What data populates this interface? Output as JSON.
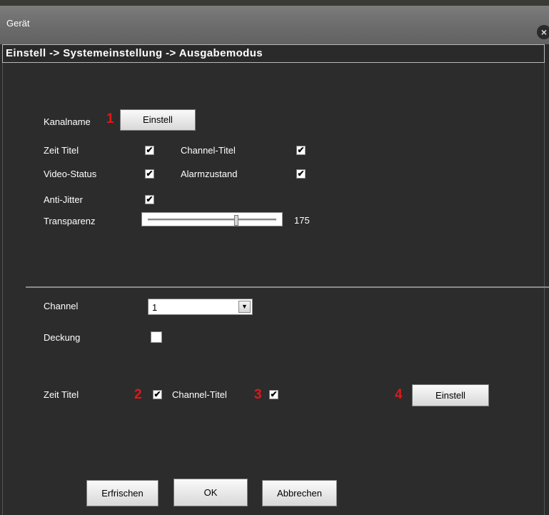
{
  "window": {
    "title": "Gerät",
    "close_icon": "×"
  },
  "breadcrumb": "Einstell -> Systemeinstellung -> Ausgabemodus",
  "section1": {
    "kanalname_label": "Kanalname",
    "kanalname_marker": "1",
    "kanalname_button": "Einstell",
    "zeit_titel": {
      "label": "Zeit Titel",
      "checked": true
    },
    "channel_titel": {
      "label": "Channel-Titel",
      "checked": true
    },
    "video_status": {
      "label": "Video-Status",
      "checked": true
    },
    "alarmzustand": {
      "label": "Alarmzustand",
      "checked": true
    },
    "anti_jitter": {
      "label": "Anti-Jitter",
      "checked": true
    },
    "transparenz": {
      "label": "Transparenz",
      "value": "175",
      "min": 0,
      "max": 255
    }
  },
  "section2": {
    "channel_label": "Channel",
    "channel_value": "1",
    "deckung": {
      "label": "Deckung",
      "checked": false
    },
    "zeit_titel": {
      "label": "Zeit Titel",
      "marker": "2",
      "checked": true
    },
    "channel_titel": {
      "label": "Channel-Titel",
      "marker": "3",
      "checked": true
    },
    "einstell_marker": "4",
    "einstell_button": "Einstell"
  },
  "footer": {
    "refresh": "Erfrischen",
    "ok": "OK",
    "cancel": "Abbrechen"
  },
  "colors": {
    "background": "#2c2c2c",
    "marker": "#e01818",
    "titlebar": "#6e6e6e"
  }
}
